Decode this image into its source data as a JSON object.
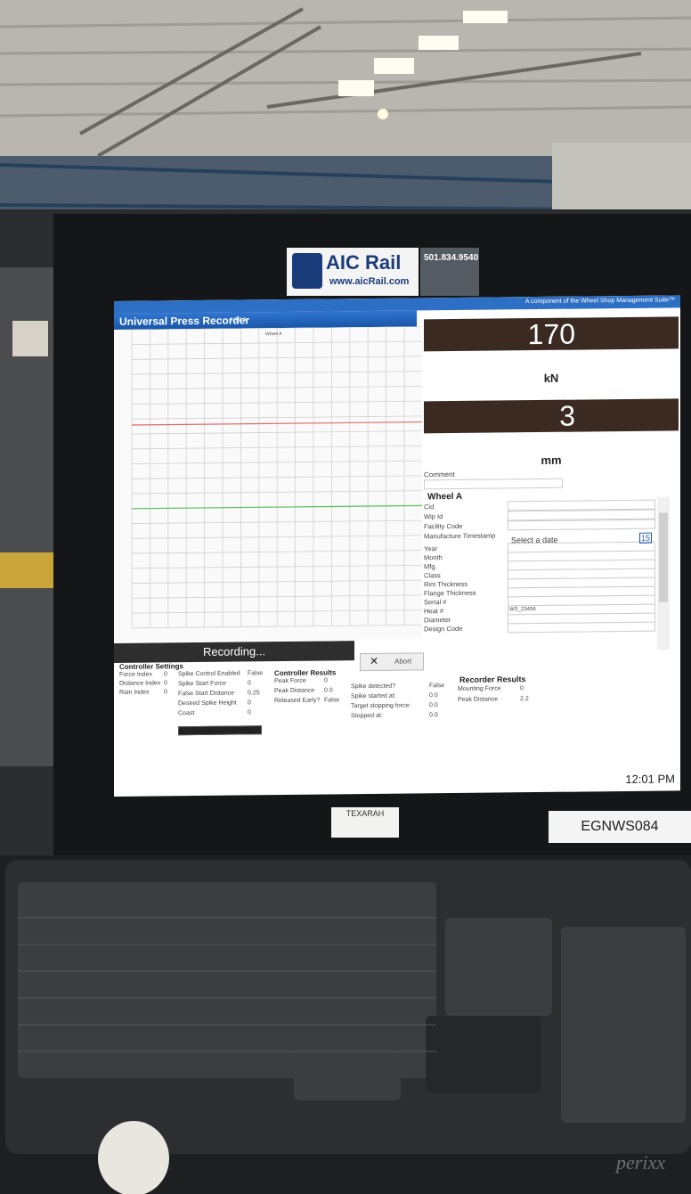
{
  "logo": {
    "brand": "AIC Rail",
    "url": "www.aicRail.com",
    "phone": "501.834.9540"
  },
  "banner": "A component of the Wheel Shop Management Suite™",
  "app": {
    "title": "Universal Press Recorder",
    "version": "6.3.8.8"
  },
  "chart_data": {
    "type": "line",
    "title": "Wheel A",
    "xlabel": "",
    "ylabel": "",
    "series": [
      {
        "values": [
          0.68,
          0.68
        ]
      },
      {
        "values": [
          0.4,
          0.4
        ]
      }
    ]
  },
  "gauges": [
    {
      "value": "170",
      "unit": "kN"
    },
    {
      "value": "3",
      "unit": "mm"
    }
  ],
  "comment_label": "Comment",
  "wheel": {
    "title": "Wheel A",
    "fields": [
      "Cid",
      "Wip Id",
      "Facility Code",
      "Manufacture Timestamp",
      "Year",
      "Month",
      "Mfg.",
      "Class",
      "Rim Thickness",
      "Flange Thickness",
      "Serial #",
      "Heat #",
      "Diameter",
      "Design Code"
    ],
    "date_placeholder": "Select a date",
    "calendar_day": "15",
    "serial_value": "WS_23456"
  },
  "recording": {
    "label": "Recording...",
    "abort": "Abort"
  },
  "controller_settings": {
    "title": "Controller Settings",
    "col1": [
      "Force Index",
      "Distance Index",
      "Rain Index"
    ],
    "col1_vals": [
      "0",
      "0",
      "0"
    ],
    "col2": [
      "Spike Control Enabled",
      "Spike Start Force",
      "False Start Distance",
      "Desired Spike Height",
      "Coast"
    ],
    "col2_vals": [
      "False",
      "0",
      "0.25",
      "0",
      "0"
    ]
  },
  "controller_results": {
    "title": "Controller Results",
    "rows": [
      "Peak Force",
      "Peak Distance",
      "Released Early?"
    ],
    "vals": [
      "0",
      "0.0",
      "False"
    ]
  },
  "spike": {
    "rows": [
      "Spike detected?",
      "Spike started at:",
      "Target stopping force:",
      "Stopped at:"
    ],
    "vals": [
      "False",
      "0.0",
      "0.0",
      "0.0"
    ]
  },
  "recorder_results": {
    "title": "Recorder Results",
    "rows": [
      "Mounting Force",
      "Peak Distance"
    ],
    "vals": [
      "0",
      "2.2"
    ]
  },
  "clock": "12:01 PM",
  "sticker": {
    "line1": "TEXARAH"
  },
  "station": "EGNWS084",
  "keyboard_brand": "perixx"
}
